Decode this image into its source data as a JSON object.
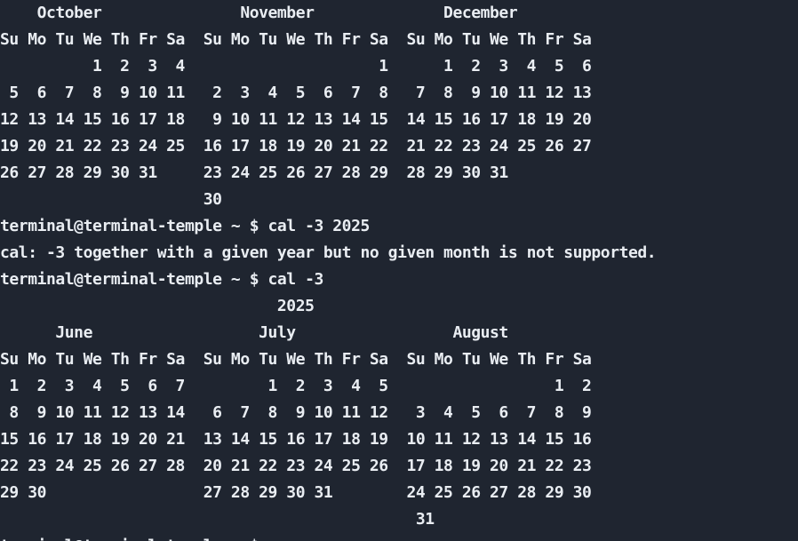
{
  "terminal": {
    "lines": [
      "    October               November              December       ",
      "Su Mo Tu We Th Fr Sa  Su Mo Tu We Th Fr Sa  Su Mo Tu We Th Fr Sa",
      "          1  2  3  4                     1      1  2  3  4  5  6",
      " 5  6  7  8  9 10 11   2  3  4  5  6  7  8   7  8  9 10 11 12 13",
      "12 13 14 15 16 17 18   9 10 11 12 13 14 15  14 15 16 17 18 19 20",
      "19 20 21 22 23 24 25  16 17 18 19 20 21 22  21 22 23 24 25 26 27",
      "26 27 28 29 30 31     23 24 25 26 27 28 29  28 29 30 31         ",
      "                      30                                        ",
      "terminal@terminal-temple ~ $ cal -3 2025",
      "cal: -3 together with a given year but no given month is not supported.",
      "terminal@terminal-temple ~ $ cal -3",
      "                              2025",
      "      June                  July                 August         ",
      "Su Mo Tu We Th Fr Sa  Su Mo Tu We Th Fr Sa  Su Mo Tu We Th Fr Sa",
      " 1  2  3  4  5  6  7         1  2  3  4  5                  1  2",
      " 8  9 10 11 12 13 14   6  7  8  9 10 11 12   3  4  5  6  7  8  9",
      "15 16 17 18 19 20 21  13 14 15 16 17 18 19  10 11 12 13 14 15 16",
      "22 23 24 25 26 27 28  20 21 22 23 24 25 26  17 18 19 20 21 22 23",
      "29 30                 27 28 29 30 31        24 25 26 27 28 29 30",
      "                                             31                 ",
      "terminal@terminal-temple ~ $ "
    ]
  }
}
